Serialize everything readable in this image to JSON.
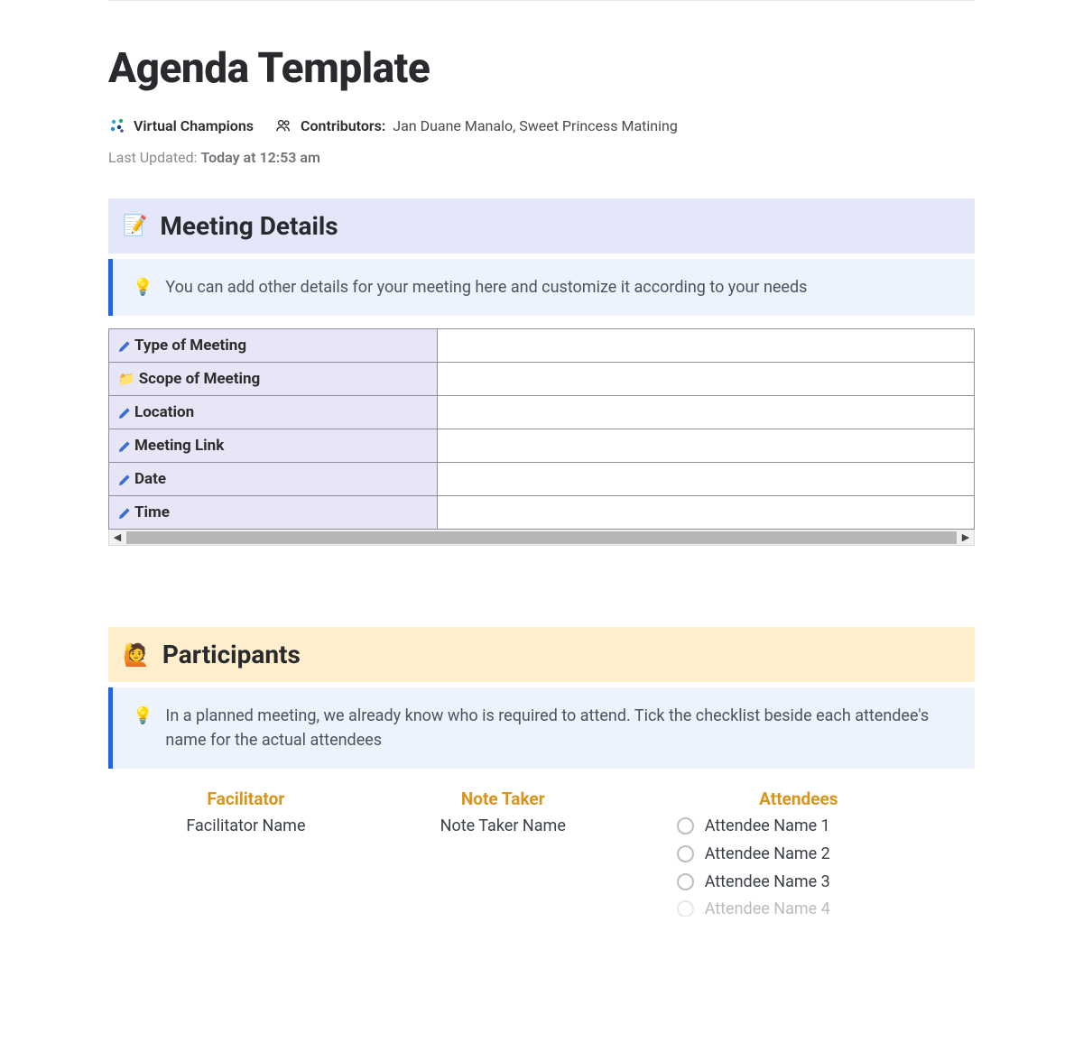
{
  "page": {
    "title": "Agenda Template"
  },
  "meta": {
    "team_name": "Virtual Champions",
    "contributors_label": "Contributors",
    "contributors_value": "Jan Duane Manalo, Sweet Princess Matining",
    "last_updated_label": "Last Updated:",
    "last_updated_value": "Today at 12:53 am"
  },
  "sections": {
    "meeting_details": {
      "title": "Meeting Details",
      "tip": "You can add other details for your meeting here and customize it according to your needs",
      "rows": [
        {
          "icon": "pen",
          "label": "Type of Meeting",
          "value": ""
        },
        {
          "icon": "folder",
          "label": "Scope of Meeting",
          "value": ""
        },
        {
          "icon": "pen",
          "label": "Location",
          "value": ""
        },
        {
          "icon": "pen",
          "label": "Meeting Link",
          "value": ""
        },
        {
          "icon": "pen",
          "label": "Date",
          "value": ""
        },
        {
          "icon": "pen",
          "label": "Time",
          "value": ""
        }
      ]
    },
    "participants": {
      "title": "Participants",
      "tip": "In a planned meeting, we already know who is required to attend. Tick the checklist beside each attendee's name for the actual attendees",
      "facilitator_label": "Facilitator",
      "facilitator_value": "Facilitator Name",
      "note_taker_label": "Note Taker",
      "note_taker_value": "Note Taker Name",
      "attendees_label": "Attendees",
      "attendees": [
        "Attendee Name 1",
        "Attendee Name 2",
        "Attendee Name 3",
        "Attendee Name 4"
      ]
    }
  }
}
